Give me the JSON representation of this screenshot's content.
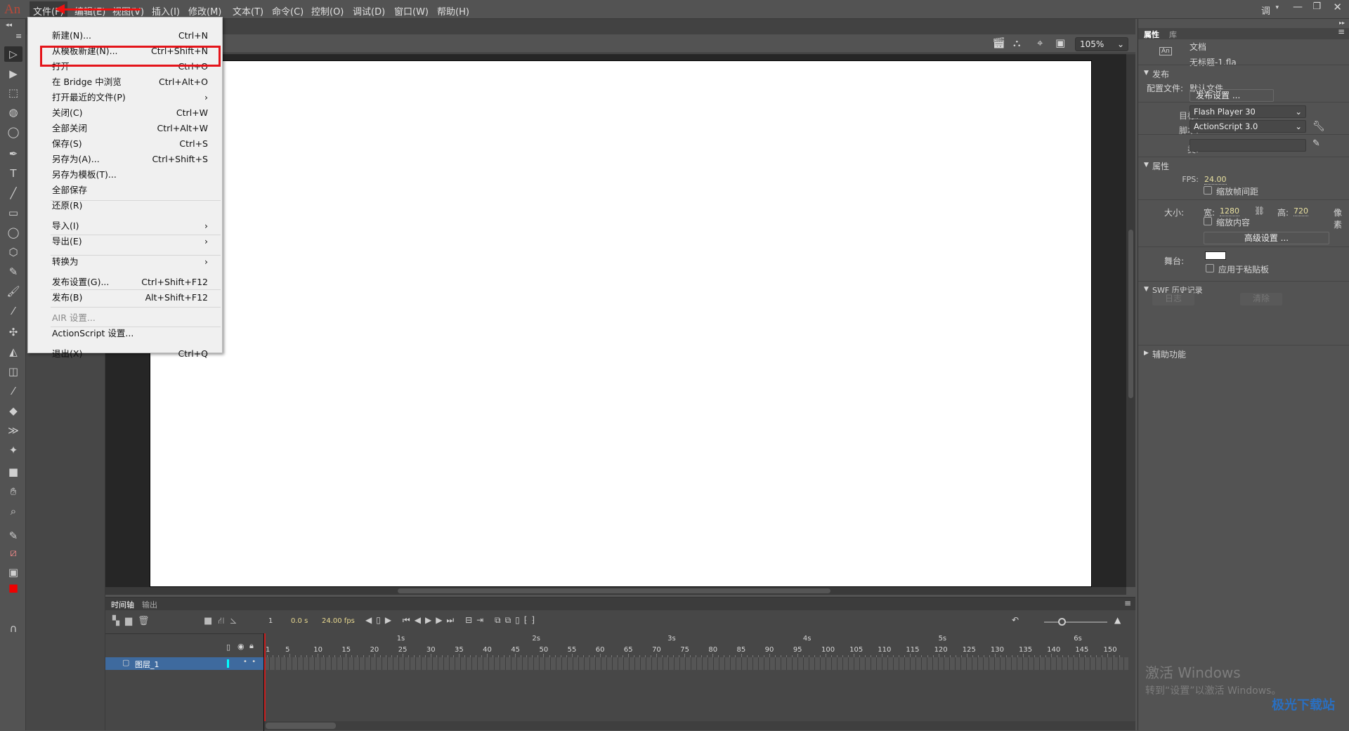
{
  "app": {
    "logo": "An",
    "workspace": "调试",
    "accent": "#e4141a"
  },
  "menubar": [
    "文件(F)",
    "编辑(E)",
    "视图(V)",
    "插入(I)",
    "修改(M)",
    "文本(T)",
    "命令(C)",
    "控制(O)",
    "调试(D)",
    "窗口(W)",
    "帮助(H)"
  ],
  "file_menu": [
    {
      "label": "新建(N)...",
      "shortcut": "Ctrl+N"
    },
    {
      "label": "从模板新建(N)...",
      "shortcut": "Ctrl+Shift+N"
    },
    {
      "label": "打开",
      "shortcut": "Ctrl+O",
      "highlighted": true
    },
    {
      "label": "在 Bridge 中浏览",
      "shortcut": "Ctrl+Alt+O"
    },
    {
      "label": "打开最近的文件(P)",
      "shortcut": "›"
    },
    {
      "label": "关闭(C)",
      "shortcut": "Ctrl+W"
    },
    {
      "label": "全部关闭",
      "shortcut": "Ctrl+Alt+W"
    },
    {
      "label": "保存(S)",
      "shortcut": "Ctrl+S"
    },
    {
      "label": "另存为(A)...",
      "shortcut": "Ctrl+Shift+S"
    },
    {
      "label": "另存为模板(T)...",
      "shortcut": ""
    },
    {
      "label": "全部保存",
      "shortcut": ""
    },
    {
      "label": "还原(R)",
      "shortcut": ""
    },
    {
      "label": "导入(I)",
      "shortcut": "›"
    },
    {
      "label": "导出(E)",
      "shortcut": "›"
    },
    {
      "label": "转换为",
      "shortcut": "›"
    },
    {
      "label": "发布设置(G)...",
      "shortcut": "Ctrl+Shift+F12"
    },
    {
      "label": "发布(B)",
      "shortcut": "Alt+Shift+F12"
    },
    {
      "label": "AIR 设置...",
      "shortcut": "",
      "disabled": true
    },
    {
      "label": "ActionScript 设置...",
      "shortcut": ""
    },
    {
      "label": "退出(X)",
      "shortcut": "Ctrl+Q"
    }
  ],
  "stage": {
    "zoom": "105%"
  },
  "tools": [
    "selection-icon",
    "subselection-icon",
    "free-transform-icon",
    "3d-rotation-icon",
    "lasso-icon",
    "pen-icon",
    "text-icon",
    "line-icon",
    "rectangle-icon",
    "oval-icon",
    "polystar-icon",
    "pencil-icon",
    "paint-brush-icon",
    "brush-icon",
    "bone-icon",
    "paint-bucket-icon",
    "ink-bottle-icon",
    "eyedropper-icon",
    "eraser-icon",
    "width-icon",
    "pin-icon",
    "camera-icon",
    "hand-icon",
    "zoom-icon",
    "stroke-color-icon",
    "fill-none-icon",
    "fill-swatch-icon",
    "fill-color-icon",
    "snap-icon"
  ],
  "timeline": {
    "tabs": [
      "时间轴",
      "输出"
    ],
    "frame": "1",
    "time": "0.0 s",
    "fps": "24.00 fps",
    "layer": "图层_1",
    "seconds": [
      "1s",
      "2s",
      "3s",
      "4s",
      "5s",
      "6s"
    ],
    "frame_labels": [
      "1",
      "5",
      "10",
      "15",
      "20",
      "25",
      "30",
      "35",
      "40",
      "45",
      "50",
      "55",
      "60",
      "65",
      "70",
      "75",
      "80",
      "85",
      "90",
      "95",
      "100",
      "105",
      "110",
      "115",
      "120",
      "125",
      "130",
      "135",
      "140",
      "145",
      "150"
    ]
  },
  "properties": {
    "tabs": [
      "属性",
      "库"
    ],
    "doc_type": "文档",
    "filename": "无标题-1.fla",
    "publish": {
      "header": "发布",
      "profile_label": "配置文件:",
      "profile": "默认文件",
      "settings_btn": "发布设置 ...",
      "target_label": "目标:",
      "target": "Flash Player 30",
      "script_label": "脚本:",
      "script": "ActionScript 3.0",
      "class_label": "类:"
    },
    "props": {
      "header": "属性",
      "fps_label": "FPS:",
      "fps": "24.00",
      "scale_spans": "缩放帧间距",
      "size_label": "大小:",
      "width_label": "宽:",
      "width": "1280",
      "height_label": "高:",
      "height": "720",
      "unit": "像素",
      "scale_content": "缩放内容",
      "advanced_btn": "高级设置 ...",
      "stage_label": "舞台:",
      "stage_color": "#ffffff",
      "apply_pasteboard": "应用于粘贴板"
    },
    "swf": {
      "header": "SWF 历史记录",
      "log_btn": "日志",
      "clear_btn": "清除"
    },
    "accessibility": "辅助功能"
  },
  "watermark": {
    "line1": "激活 Windows",
    "line2": "转到“设置”以激活 Windows。",
    "site": "极光下载站"
  }
}
